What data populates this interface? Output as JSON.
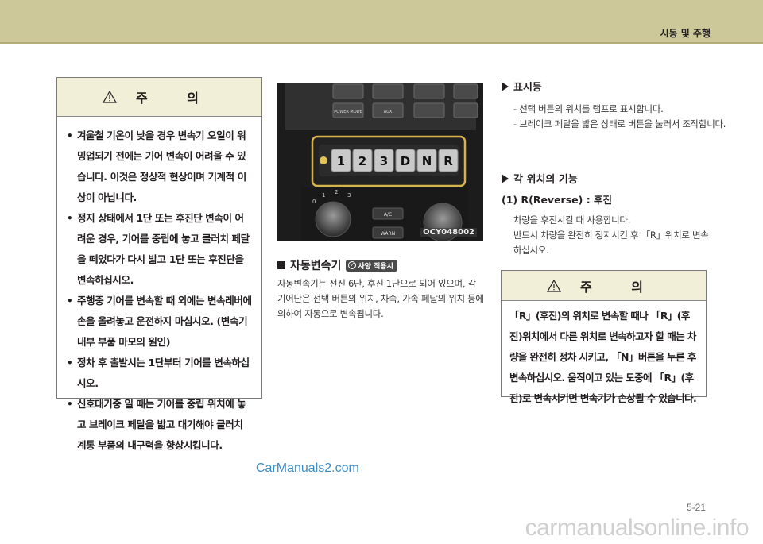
{
  "header": {
    "section_title": "시동 및 주행"
  },
  "caution_left": {
    "title": "주 의",
    "items": [
      "겨울철 기온이 낮을 경우 변속기 오일이 워밍업되기 전에는 기어 변속이 어려울 수 있습니다. 이것은 정상적 현상이며 기계적 이상이 아닙니다.",
      "정지 상태에서 1단 또는 후진단 변속이 어려운 경우, 기어를 중립에 놓고 클러치 페달을 떼었다가 다시 밟고 1단 또는 후진단을 변속하십시오.",
      "주행중 기어를 변속할 때 외에는 변속레버에 손을 올려놓고 운전하지 마십시오. (변속기 내부 부품 마모의 원인)",
      "정차 후 출발시는 1단부터 기어를 변속하십시오.",
      "신호대기중 일 때는 기어를 중립 위치에 놓고 브레이크 페달을 밟고 대기해야 클러치 계통 부품의 내구력을 향상시킵니다."
    ]
  },
  "photo": {
    "label": "OCY048002",
    "gear_buttons": [
      "1",
      "2",
      "3",
      "D",
      "N",
      "R"
    ],
    "upper_buttons": [
      "POWER MODE",
      "AUX"
    ],
    "knob_marks": [
      "0",
      "1",
      "2",
      "3"
    ],
    "small_buttons": [
      "A/C",
      "WARN"
    ],
    "colors": {
      "frame_highlight": "#d8b24a",
      "panel": "#262626"
    }
  },
  "auto_section": {
    "heading": "자동변속기",
    "badge": "사양 적용시",
    "body": "자동변속기는 전진 6단, 후진 1단으로 되어 있으며, 각 기어단은 선택 버튼의 위치, 차속, 가속 페달의 위치 등에 의하여 자동으로 변속됩니다."
  },
  "display_section": {
    "heading": "표시등",
    "items": [
      "- 선택 버튼의 위치를 램프로 표시합니다.",
      "- 브레이크 페달을 밟은 상태로 버튼을 눌러서 조작합니다."
    ]
  },
  "position_section": {
    "heading": "각 위치의 기능",
    "sub_heading": "(1) R(Reverse) : 후진",
    "lines": [
      "차량을 후진시킬 때 사용합니다.",
      "반드시 차량을 완전히 정지시킨 후 「R」위치로 변속하십시오."
    ]
  },
  "caution_right": {
    "title": "주 의",
    "text": "「R」(후진)의 위치로 변속할 때나 「R」(후진)위치에서 다른 위치로 변속하고자 할 때는 차량을 완전히 정차 시키고, 「N」버튼을 누른 후 변속하십시오. 움직이고 있는 도중에 「R」(후진)로 변속시키면 변속기가 손상될 수 있습니다."
  },
  "watermark": "CarManuals2.com",
  "page_number": "5-21",
  "footer_watermark": "carmanualsonline.info"
}
